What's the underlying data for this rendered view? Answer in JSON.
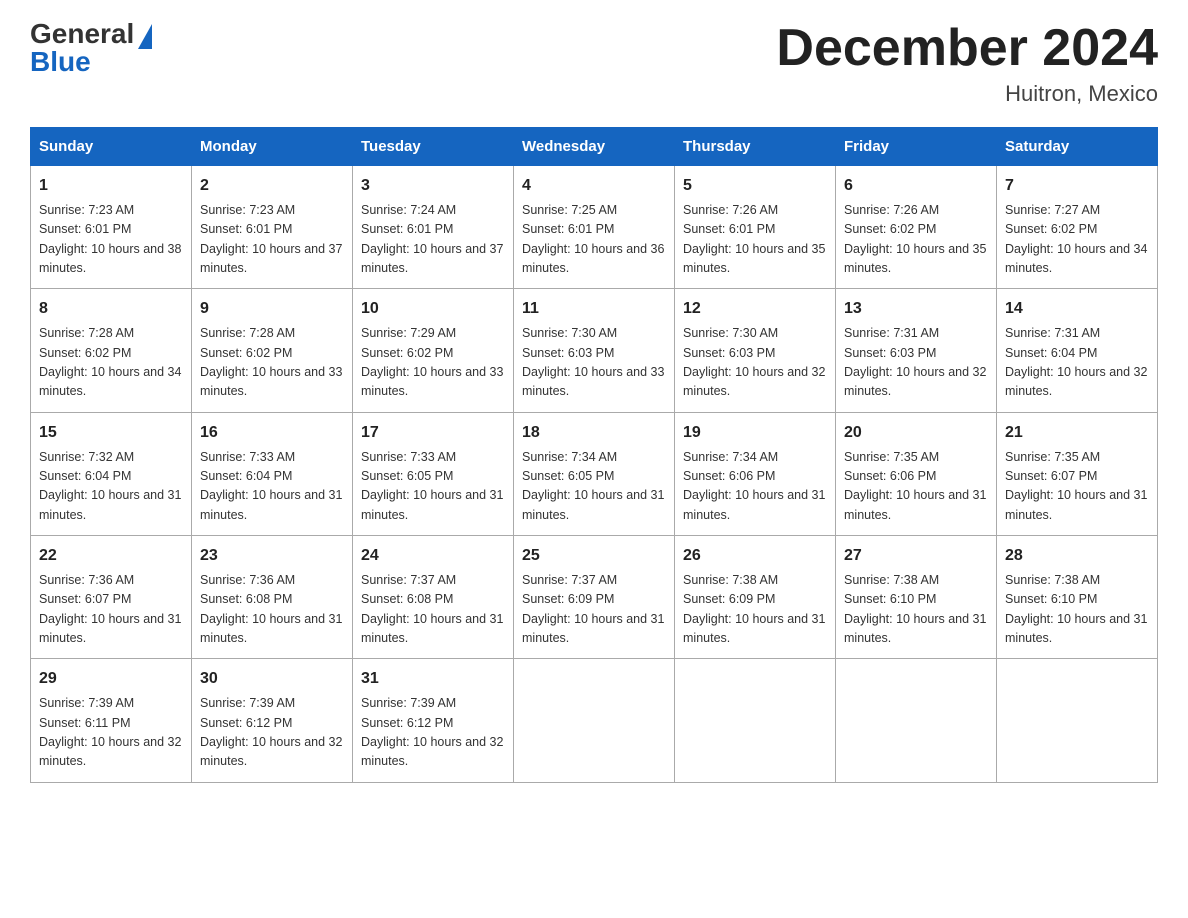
{
  "logo": {
    "general": "General",
    "blue": "Blue"
  },
  "title": "December 2024",
  "location": "Huitron, Mexico",
  "headers": [
    "Sunday",
    "Monday",
    "Tuesday",
    "Wednesday",
    "Thursday",
    "Friday",
    "Saturday"
  ],
  "weeks": [
    [
      {
        "day": "1",
        "sunrise": "7:23 AM",
        "sunset": "6:01 PM",
        "daylight": "10 hours and 38 minutes."
      },
      {
        "day": "2",
        "sunrise": "7:23 AM",
        "sunset": "6:01 PM",
        "daylight": "10 hours and 37 minutes."
      },
      {
        "day": "3",
        "sunrise": "7:24 AM",
        "sunset": "6:01 PM",
        "daylight": "10 hours and 37 minutes."
      },
      {
        "day": "4",
        "sunrise": "7:25 AM",
        "sunset": "6:01 PM",
        "daylight": "10 hours and 36 minutes."
      },
      {
        "day": "5",
        "sunrise": "7:26 AM",
        "sunset": "6:01 PM",
        "daylight": "10 hours and 35 minutes."
      },
      {
        "day": "6",
        "sunrise": "7:26 AM",
        "sunset": "6:02 PM",
        "daylight": "10 hours and 35 minutes."
      },
      {
        "day": "7",
        "sunrise": "7:27 AM",
        "sunset": "6:02 PM",
        "daylight": "10 hours and 34 minutes."
      }
    ],
    [
      {
        "day": "8",
        "sunrise": "7:28 AM",
        "sunset": "6:02 PM",
        "daylight": "10 hours and 34 minutes."
      },
      {
        "day": "9",
        "sunrise": "7:28 AM",
        "sunset": "6:02 PM",
        "daylight": "10 hours and 33 minutes."
      },
      {
        "day": "10",
        "sunrise": "7:29 AM",
        "sunset": "6:02 PM",
        "daylight": "10 hours and 33 minutes."
      },
      {
        "day": "11",
        "sunrise": "7:30 AM",
        "sunset": "6:03 PM",
        "daylight": "10 hours and 33 minutes."
      },
      {
        "day": "12",
        "sunrise": "7:30 AM",
        "sunset": "6:03 PM",
        "daylight": "10 hours and 32 minutes."
      },
      {
        "day": "13",
        "sunrise": "7:31 AM",
        "sunset": "6:03 PM",
        "daylight": "10 hours and 32 minutes."
      },
      {
        "day": "14",
        "sunrise": "7:31 AM",
        "sunset": "6:04 PM",
        "daylight": "10 hours and 32 minutes."
      }
    ],
    [
      {
        "day": "15",
        "sunrise": "7:32 AM",
        "sunset": "6:04 PM",
        "daylight": "10 hours and 31 minutes."
      },
      {
        "day": "16",
        "sunrise": "7:33 AM",
        "sunset": "6:04 PM",
        "daylight": "10 hours and 31 minutes."
      },
      {
        "day": "17",
        "sunrise": "7:33 AM",
        "sunset": "6:05 PM",
        "daylight": "10 hours and 31 minutes."
      },
      {
        "day": "18",
        "sunrise": "7:34 AM",
        "sunset": "6:05 PM",
        "daylight": "10 hours and 31 minutes."
      },
      {
        "day": "19",
        "sunrise": "7:34 AM",
        "sunset": "6:06 PM",
        "daylight": "10 hours and 31 minutes."
      },
      {
        "day": "20",
        "sunrise": "7:35 AM",
        "sunset": "6:06 PM",
        "daylight": "10 hours and 31 minutes."
      },
      {
        "day": "21",
        "sunrise": "7:35 AM",
        "sunset": "6:07 PM",
        "daylight": "10 hours and 31 minutes."
      }
    ],
    [
      {
        "day": "22",
        "sunrise": "7:36 AM",
        "sunset": "6:07 PM",
        "daylight": "10 hours and 31 minutes."
      },
      {
        "day": "23",
        "sunrise": "7:36 AM",
        "sunset": "6:08 PM",
        "daylight": "10 hours and 31 minutes."
      },
      {
        "day": "24",
        "sunrise": "7:37 AM",
        "sunset": "6:08 PM",
        "daylight": "10 hours and 31 minutes."
      },
      {
        "day": "25",
        "sunrise": "7:37 AM",
        "sunset": "6:09 PM",
        "daylight": "10 hours and 31 minutes."
      },
      {
        "day": "26",
        "sunrise": "7:38 AM",
        "sunset": "6:09 PM",
        "daylight": "10 hours and 31 minutes."
      },
      {
        "day": "27",
        "sunrise": "7:38 AM",
        "sunset": "6:10 PM",
        "daylight": "10 hours and 31 minutes."
      },
      {
        "day": "28",
        "sunrise": "7:38 AM",
        "sunset": "6:10 PM",
        "daylight": "10 hours and 31 minutes."
      }
    ],
    [
      {
        "day": "29",
        "sunrise": "7:39 AM",
        "sunset": "6:11 PM",
        "daylight": "10 hours and 32 minutes."
      },
      {
        "day": "30",
        "sunrise": "7:39 AM",
        "sunset": "6:12 PM",
        "daylight": "10 hours and 32 minutes."
      },
      {
        "day": "31",
        "sunrise": "7:39 AM",
        "sunset": "6:12 PM",
        "daylight": "10 hours and 32 minutes."
      },
      null,
      null,
      null,
      null
    ]
  ]
}
